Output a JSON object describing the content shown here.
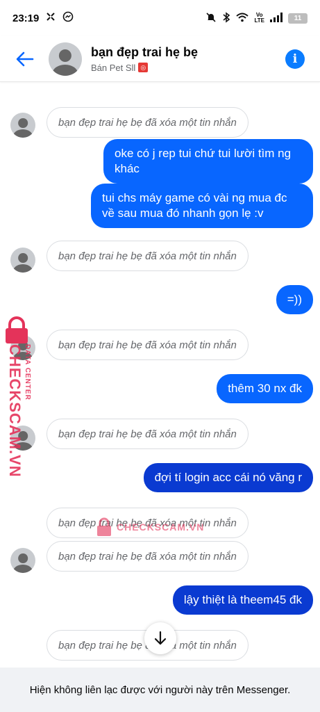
{
  "status_bar": {
    "time": "23:19",
    "battery": "11"
  },
  "header": {
    "contact_name": "bạn đẹp trai hẹ bẹ",
    "contact_subtitle": "Bán Pet Sll"
  },
  "messages": [
    {
      "type": "deleted",
      "text": "bạn đẹp trai hẹ bẹ đã xóa một tin nhắn"
    },
    {
      "type": "outgoing",
      "text": "oke có j rep tui chứ tui lười tìm ng khác"
    },
    {
      "type": "outgoing",
      "text": "tui chs máy game có vài ng mua đc về sau mua đó nhanh gọn lẹ :v"
    },
    {
      "type": "deleted",
      "text": "bạn đẹp trai hẹ bẹ đã xóa một tin nhắn"
    },
    {
      "type": "outgoing",
      "text": "=))"
    },
    {
      "type": "deleted",
      "text": "bạn đẹp trai hẹ bẹ đã xóa một tin nhắn"
    },
    {
      "type": "outgoing",
      "text": "thêm 30 nx đk"
    },
    {
      "type": "deleted",
      "text": "bạn đẹp trai hẹ bẹ đã xóa một tin nhắn"
    },
    {
      "type": "outgoing",
      "text": "đợi tí login acc cái nó văng r"
    },
    {
      "type": "deleted",
      "text": "bạn đẹp trai hẹ bẹ đã xóa một tin nhắn"
    },
    {
      "type": "deleted",
      "text": "bạn đẹp trai hẹ bẹ đã xóa một tin nhắn"
    },
    {
      "type": "outgoing",
      "text": "lậy thiệt là theem45 đk"
    },
    {
      "type": "deleted",
      "text": "bạn đẹp trai hẹ bẹ đã xóa một tin nhắn"
    }
  ],
  "footer": {
    "notice": "Hiện không liên lạc được với người này trên Messenger."
  },
  "watermark": {
    "brand": "CHECKSCAM.VN",
    "tagline": "DATA CENTER",
    "center": "CHECKSCAM.VN"
  },
  "colors": {
    "accent": "#0866ff",
    "bubble_dark": "#0a3ad1",
    "watermark": "#e4335a"
  },
  "icons": {
    "back": "arrow-left-icon",
    "info": "info-icon",
    "scroll_down": "arrow-down-icon"
  }
}
